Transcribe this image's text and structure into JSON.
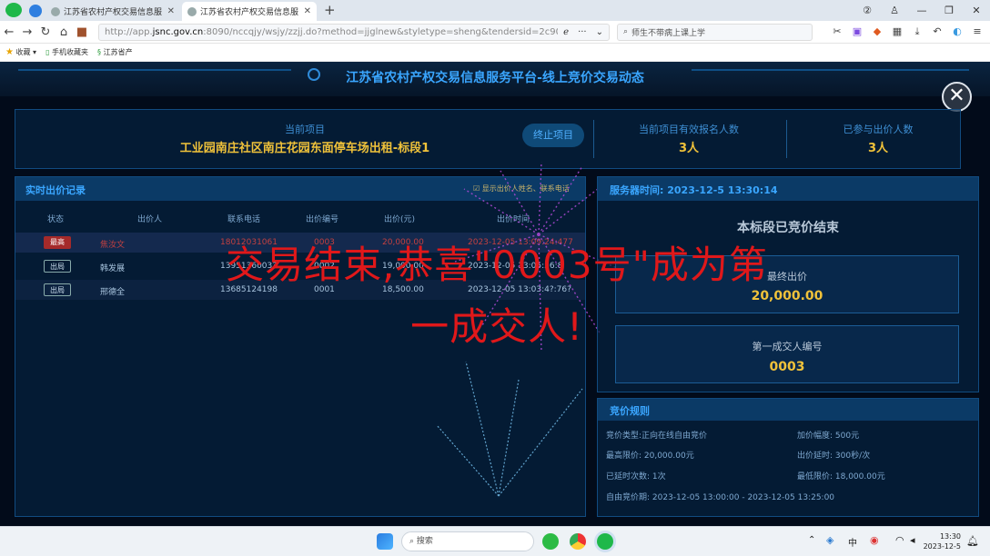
{
  "browser": {
    "tabs": [
      {
        "title": "江苏省农村产权交易信息服务"
      },
      {
        "title": "江苏省农村产权交易信息服务"
      }
    ],
    "new_tab": "+",
    "address": {
      "prefix": "http://app.",
      "domain": "jsnc.gov.cn",
      "rest": ":8090/nccqjy/wsjy/zzjj.do?method=jjglnew&styletype=sheng&tendersid=2c90b22"
    },
    "search_text": "师生不带病上课上学",
    "bookmarks": [
      "收藏",
      "手机收藏夹",
      "江苏省产"
    ]
  },
  "page": {
    "title": "江苏省农村产权交易信息服务平台-线上竞价交易动态",
    "current_item_label": "当前项目",
    "current_item_name": "工业园南庄社区南庄花园东面停车场出租-标段1",
    "stop_button": "终止项目",
    "signup_label": "当前项目有效报名人数",
    "signup_count": "3人",
    "bidders_label": "已参与出价人数",
    "bidders_count": "3人",
    "records_title": "实时出价记录",
    "show_option": "显示出价人姓名、联系电话",
    "columns": [
      "状态",
      "出价人",
      "联系电话",
      "出价编号",
      "出价(元)",
      "出价时间"
    ],
    "rows": [
      {
        "status": "最高",
        "bidder": "焦汝文",
        "phone": "18012031061",
        "no": "0003",
        "price": "20,000.00",
        "time": "2023-12-05 13:09:24:477"
      },
      {
        "status": "出局",
        "bidder": "韩发展",
        "phone": "13951360033",
        "no": "0002",
        "price": "19,000.00",
        "time": "2023-12-05 13:05:56:8"
      },
      {
        "status": "出局",
        "bidder": "邢德全",
        "phone": "13685124198",
        "no": "0001",
        "price": "18,500.00",
        "time": "2023-12-05 13:03:4?:76?"
      }
    ],
    "server_time_label": "服务器时间:",
    "server_time": "2023-12-5 13:30:14",
    "ended_text": "本标段已竞价结束",
    "top_price_label": "最终出价",
    "top_price": "20,000.00",
    "winner_label": "第一成交人编号",
    "winner_no": "0003",
    "rules_title": "竞价规则",
    "rules": {
      "type": "竞价类型:正向在线自由竞价",
      "increment": "加价幅度: 500元",
      "max_limit": "最高限价: 20,000.00元",
      "delay": "出价延时: 300秒/次",
      "delays_done": "已延时次数: 1次",
      "min_limit": "最低限价: 18,000.00元",
      "period": "自由竞价期: 2023-12-05 13:00:00 - 2023-12-05 13:25:00"
    },
    "overlay_line1": "交易结束,恭喜\"0003号\"成为第",
    "overlay_line2": "一成交人!",
    "close_glyph": "✕"
  },
  "taskbar": {
    "search": "搜索",
    "ime": "中",
    "time": "13:30",
    "date": "2023-12-5"
  },
  "colors": {
    "accent": "#3aa6ff",
    "gold": "#f0c23a",
    "alert": "#e0181a",
    "panel": "#062240"
  }
}
